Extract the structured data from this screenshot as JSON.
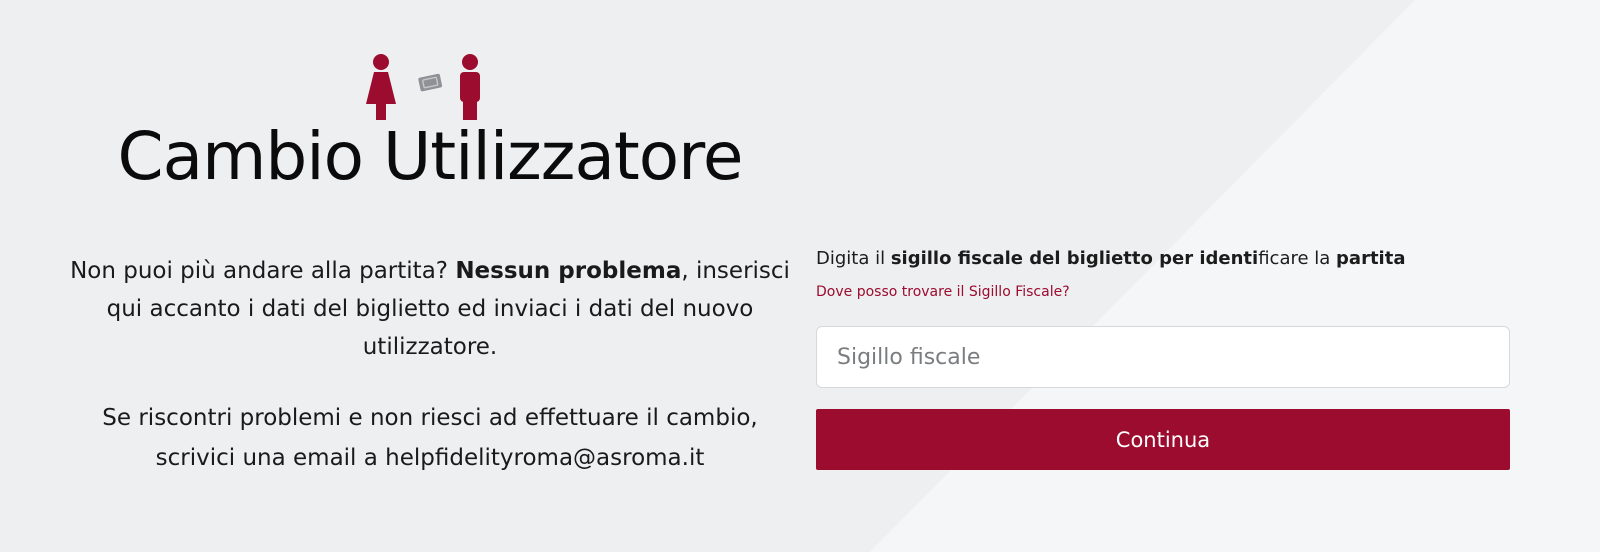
{
  "icons": {
    "left_person": "woman-icon",
    "ticket": "ticket-icon",
    "right_person": "man-icon",
    "accent_color": "#9b0c2e",
    "ticket_color": "#8e9196"
  },
  "header": {
    "title": "Cambio Utilizzatore"
  },
  "intro": {
    "text_before": "Non puoi più andare alla partita? ",
    "text_bold": "Nessun problema",
    "text_after": ", inserisci qui accanto i dati del biglietto ed inviaci i dati del nuovo utilizzatore."
  },
  "help": {
    "line1": "Se riscontri problemi e non riesci ad effettuare il cambio,",
    "line2": "scrivici una email a helpfidelityroma@asroma.it"
  },
  "form": {
    "instruction_parts": [
      "Digita il ",
      "sigillo fiscale del biglietto per identi",
      "ficare la ",
      "partita"
    ],
    "help_link": "Dove posso trovare il Sigillo Fiscale?",
    "input_value": "",
    "input_placeholder": "Sigillo fiscale",
    "submit_label": "Continua"
  },
  "colors": {
    "background": "#eeeff1",
    "accent": "#9b0c2e",
    "input_border": "#d6d8db"
  }
}
